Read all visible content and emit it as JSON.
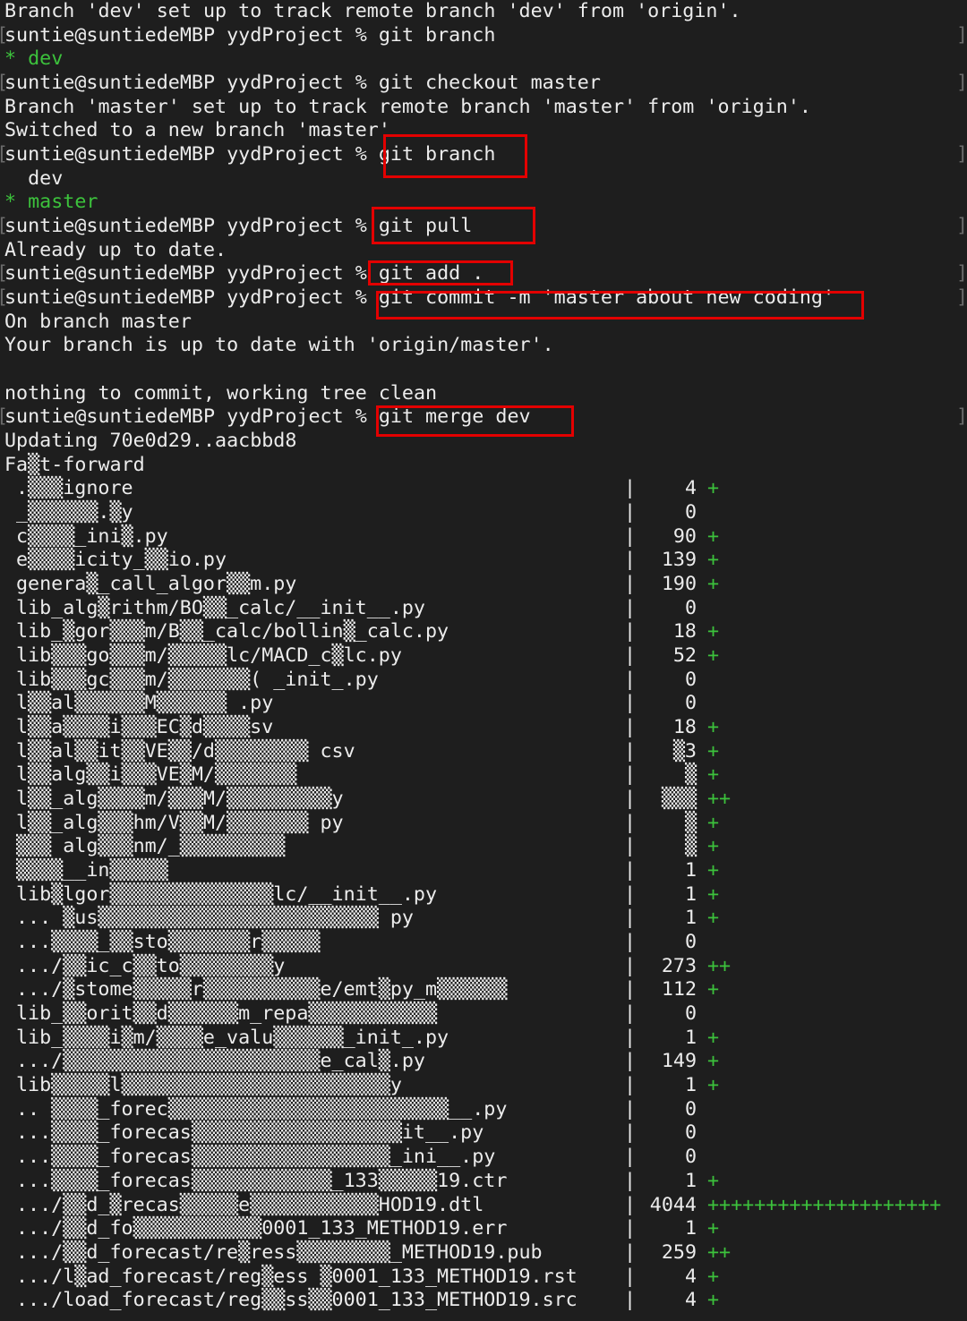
{
  "terminal": {
    "prompt": "suntie@suntiedeMBP yydProject % ",
    "highlight_color": "#e30000",
    "accent_green": "#3cc23c",
    "lines": [
      {
        "type": "text",
        "text": "Branch 'dev' set up to track remote branch 'dev' from 'origin'."
      },
      {
        "type": "prompt",
        "cmd": "git branch"
      },
      {
        "type": "text",
        "text": "* dev",
        "green": true
      },
      {
        "type": "prompt",
        "cmd": "git checkout master"
      },
      {
        "type": "text",
        "text": "Branch 'master' set up to track remote branch 'master' from 'origin'."
      },
      {
        "type": "text",
        "text": "Switched to a new branch 'master'"
      },
      {
        "type": "prompt",
        "cmd": "git branch",
        "highlight": true
      },
      {
        "type": "text",
        "text": "  dev"
      },
      {
        "type": "text",
        "text": "* master",
        "green": true
      },
      {
        "type": "prompt",
        "cmd": "git pull",
        "highlight": true
      },
      {
        "type": "text",
        "text": "Already up to date."
      },
      {
        "type": "prompt",
        "cmd": "git add .",
        "highlight": true
      },
      {
        "type": "prompt",
        "cmd": "git commit -m 'master about new coding'",
        "highlight": true
      },
      {
        "type": "text",
        "text": "On branch master"
      },
      {
        "type": "text",
        "text": "Your branch is up to date with 'origin/master'."
      },
      {
        "type": "text",
        "text": ""
      },
      {
        "type": "text",
        "text": "nothing to commit, working tree clean"
      },
      {
        "type": "prompt",
        "cmd": "git merge dev",
        "highlight": true
      },
      {
        "type": "text",
        "text": "Updating 70e0d29..aacbbd8"
      },
      {
        "type": "text",
        "text": "Fa▒t-forward"
      }
    ],
    "diffstat": [
      {
        "file": ".▒▒▒ignore",
        "count": "4",
        "plus": "+"
      },
      {
        "file": "_▒▒▒▒▒▒.▒y",
        "count": "0",
        "plus": ""
      },
      {
        "file": "c▒▒▒▒_ini▒.py",
        "count": "90",
        "plus": "+"
      },
      {
        "file": "e▒▒▒▒icity_▒▒io.py",
        "count": "139",
        "plus": "+"
      },
      {
        "file": "genera▒_call_algor▒▒m.py",
        "count": "190",
        "plus": "+"
      },
      {
        "file": "lib_alg▒rithm/BO▒▒_calc/__init__.py",
        "count": "0",
        "plus": ""
      },
      {
        "file": "lib_▒gor▒▒▒m/B▒▒_calc/bollin▒_calc.py",
        "count": "18",
        "plus": "+"
      },
      {
        "file": "lib▒▒▒go▒▒▒m/▒▒▒▒▒lc/MACD_c▒lc.py",
        "count": "52",
        "plus": "+"
      },
      {
        "file": "lib▒▒▒gc▒▒▒m/▒▒▒▒▒▒▒( _init_.py",
        "count": "0",
        "plus": ""
      },
      {
        "file": "l▒▒al▒▒▒▒▒▒M▒▒▒▒▒▒ .py",
        "count": "0",
        "plus": ""
      },
      {
        "file": "l▒▒a▒▒▒▒i▒▒▒EC▒d▒▒▒▒sv",
        "count": "18",
        "plus": "+"
      },
      {
        "file": "l▒▒al▒▒it▒▒VE▒▒/d▒▒▒▒▒▒▒▒ csv",
        "count": "▒3",
        "plus": "+"
      },
      {
        "file": "l▒▒alg▒▒i▒▒▒VE▒M/▒▒▒▒▒▒▒",
        "count": "▒",
        "plus": "+"
      },
      {
        "file": "l▒▒_alg▒▒▒▒m/▒▒▒M/▒▒▒▒▒▒▒▒▒y",
        "count": "▒▒▒",
        "plus": "++"
      },
      {
        "file": "l▒▒_alg▒▒▒hm/V▒▒M/▒▒▒▒▒▒▒ py",
        "count": "▒",
        "plus": "+"
      },
      {
        "file": "▒▒▒ alg▒▒▒nm/_▒▒▒▒▒▒▒▒▒",
        "count": "▒",
        "plus": "+"
      },
      {
        "file": "▒▒▒▒__in▒▒▒▒▒",
        "count": "1",
        "plus": "+"
      },
      {
        "file": "lib▒lgor▒▒▒▒▒▒▒▒▒▒▒▒▒▒lc/__init__.py",
        "count": "1",
        "plus": "+"
      },
      {
        "file": "... ▒us▒▒▒▒▒▒▒▒▒▒▒▒▒▒▒▒▒▒▒▒▒▒▒▒ py",
        "count": "1",
        "plus": "+"
      },
      {
        "file": "...▒▒▒▒_▒▒sto▒▒▒▒▒▒▒r▒▒▒▒▒",
        "count": "0",
        "plus": ""
      },
      {
        "file": ".../▒▒ic_c▒▒to▒▒▒▒▒▒▒▒y",
        "count": "273",
        "plus": "++"
      },
      {
        "file": ".../▒stome▒▒▒▒▒r▒▒▒▒▒▒▒▒▒▒e/emt▒py_m▒▒▒▒▒▒",
        "count": "112",
        "plus": "+"
      },
      {
        "file": "lib_▒▒orit▒▒d▒▒▒▒▒▒m_repa▒▒▒▒▒▒▒▒▒▒▒",
        "count": "0",
        "plus": ""
      },
      {
        "file": "lib_▒▒▒▒i▒m/▒▒▒▒e_valu▒▒▒▒▒▒_init_.py",
        "count": "1",
        "plus": "+"
      },
      {
        "file": ".../▒▒▒▒▒▒▒▒▒▒▒▒▒▒▒▒▒▒▒▒▒▒e_cal▒.py",
        "count": "149",
        "plus": "+"
      },
      {
        "file": "lib▒▒▒▒▒l▒▒▒▒▒▒▒▒▒▒▒▒▒▒▒▒▒▒▒▒▒▒▒y",
        "count": "1",
        "plus": "+"
      },
      {
        "file": ".. ▒▒▒▒_forec▒▒▒▒▒▒▒▒▒▒▒▒▒▒▒▒▒▒▒▒▒▒▒▒__.py",
        "count": "0",
        "plus": ""
      },
      {
        "file": "...▒▒▒▒_forecas▒▒▒▒▒▒▒▒▒▒▒▒▒▒▒▒▒▒it__.py",
        "count": "0",
        "plus": ""
      },
      {
        "file": "...▒▒▒▒_forecas▒▒▒▒▒▒▒▒▒▒▒▒▒▒▒▒▒_ini__.py",
        "count": "0",
        "plus": ""
      },
      {
        "file": "...▒▒▒▒_forecas▒▒▒▒▒▒▒▒▒▒▒▒_133▒▒▒▒▒19.ctr",
        "count": "1",
        "plus": "+"
      },
      {
        "file": ".../▒▒d_▒recas▒▒▒▒▒e▒▒▒▒▒▒▒▒▒▒▒HOD19.dtl",
        "count": "4044",
        "plus": "++++++++++++++++++++"
      },
      {
        "file": ".../▒▒d_fo▒▒▒▒▒▒▒▒▒▒▒0001_133_METHOD19.err",
        "count": "1",
        "plus": "+"
      },
      {
        "file": ".../▒▒d_forecast/re▒ress▒▒▒▒▒▒▒▒_METHOD19.pub",
        "count": "259",
        "plus": "++"
      },
      {
        "file": ".../l▒ad_forecast/reg▒ess ▒0001_133_METHOD19.rst",
        "count": "4",
        "plus": "+"
      },
      {
        "file": ".../load_forecast/reg▒▒ss▒▒0001_133_METHOD19.src",
        "count": "4",
        "plus": "+"
      }
    ]
  }
}
